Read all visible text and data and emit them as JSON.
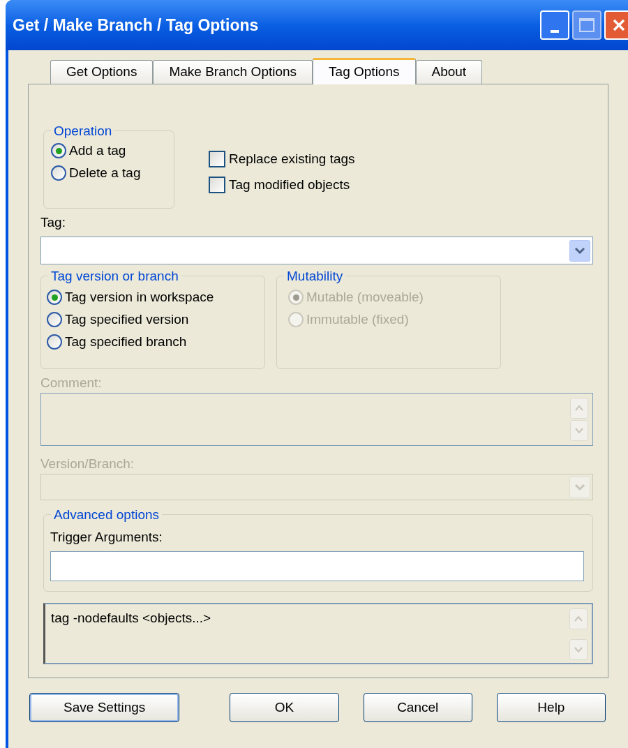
{
  "window": {
    "title": "Get / Make Branch / Tag Options"
  },
  "tabs": [
    {
      "label": "Get Options",
      "selected": false
    },
    {
      "label": "Make Branch Options",
      "selected": false
    },
    {
      "label": "Tag Options",
      "selected": true
    },
    {
      "label": "About",
      "selected": false
    }
  ],
  "operation": {
    "title": "Operation",
    "options": [
      {
        "label": "Add a tag",
        "selected": true
      },
      {
        "label": "Delete a tag",
        "selected": false
      }
    ]
  },
  "checkboxes": [
    {
      "label": "Replace existing tags",
      "checked": false
    },
    {
      "label": "Tag modified objects",
      "checked": false
    }
  ],
  "tag_field": {
    "label": "Tag:"
  },
  "tag_version": {
    "title": "Tag version or branch",
    "options": [
      {
        "label": "Tag version in workspace",
        "selected": true
      },
      {
        "label": "Tag specified version",
        "selected": false
      },
      {
        "label": "Tag specified branch",
        "selected": false
      }
    ]
  },
  "mutability": {
    "title": "Mutability",
    "disabled": true,
    "options": [
      {
        "label": "Mutable (moveable)",
        "selected": true
      },
      {
        "label": "Immutable (fixed)",
        "selected": false
      }
    ]
  },
  "comment": {
    "label": "Comment:",
    "disabled": true
  },
  "version_branch": {
    "label": "Version/Branch:",
    "disabled": true
  },
  "advanced": {
    "title": "Advanced options",
    "trigger_label": "Trigger Arguments:"
  },
  "command_preview": {
    "text": "tag -nodefaults <objects...>"
  },
  "buttons": [
    {
      "label": "Save Settings",
      "default": true
    },
    {
      "label": "OK",
      "default": false
    },
    {
      "label": "Cancel",
      "default": false
    },
    {
      "label": "Help",
      "default": false
    }
  ]
}
